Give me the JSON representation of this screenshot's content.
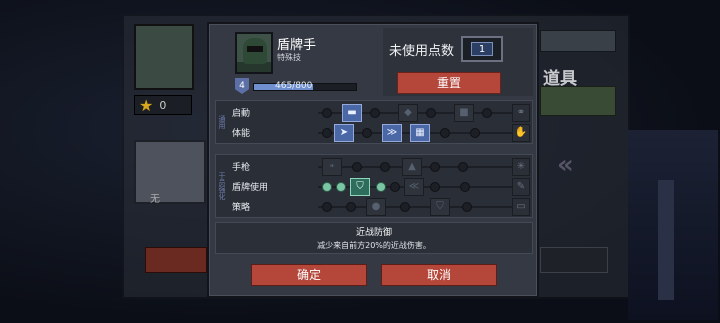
{
  "background": {
    "level_value": "0",
    "weapon_label": "无",
    "items_title": "道具"
  },
  "character": {
    "name": "盾牌手",
    "subtitle": "特殊技",
    "level": "4",
    "xp_text": "465/800",
    "xp_fraction": 0.58
  },
  "points": {
    "label": "未使用点数",
    "value": "1"
  },
  "buttons": {
    "reset": "重置",
    "confirm": "确定",
    "cancel": "取消"
  },
  "groups": [
    {
      "tag": "通用",
      "rows": [
        {
          "label": "启動"
        },
        {
          "label": "体能"
        }
      ]
    },
    {
      "tag": "干员强化",
      "rows": [
        {
          "label": "手枪"
        },
        {
          "label": "盾牌使用"
        },
        {
          "label": "策略"
        }
      ]
    }
  ],
  "description": {
    "title": "近战防御",
    "text": "减少来自前方20%的近战伤害。"
  },
  "colors": {
    "accent_red": "#b4463a",
    "node_active": "#7ac6a4",
    "skill_active_blue": "#4b68a6",
    "panel": "#343943"
  }
}
